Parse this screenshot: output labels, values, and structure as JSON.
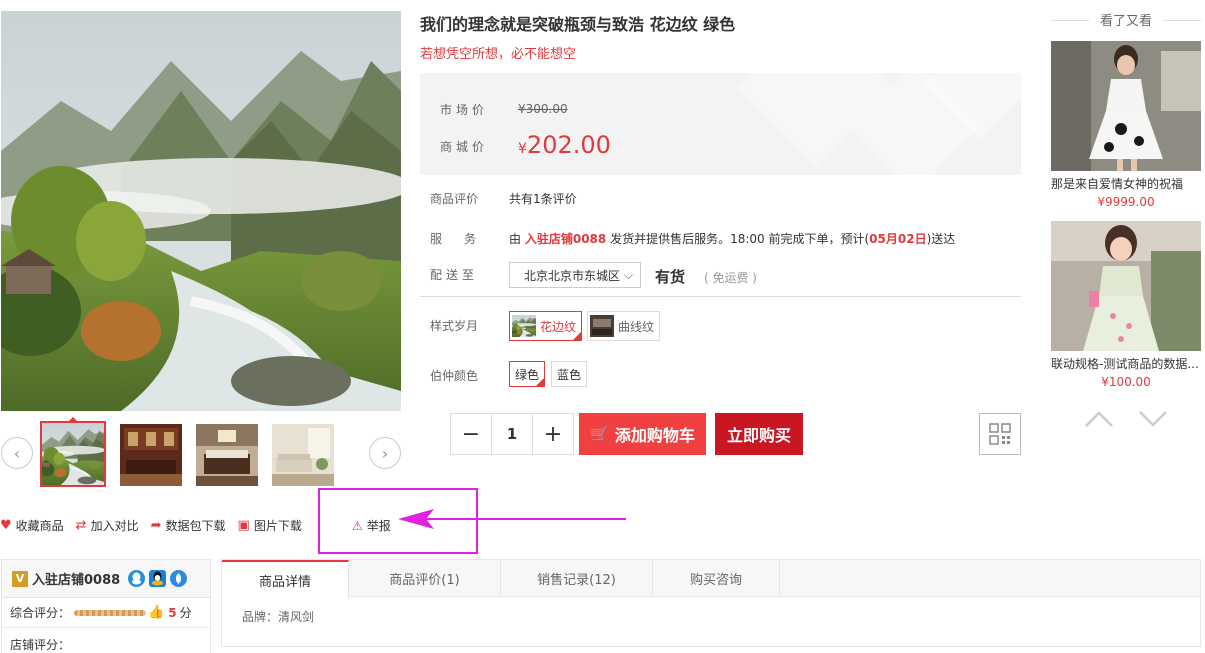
{
  "product": {
    "title": "我们的理念就是突破瓶颈与致浩 花边纹 绿色",
    "subtitle": "若想凭空所想，必不能想空",
    "market_price_label": "市场价",
    "market_price": "¥300.00",
    "shop_price_label": "商城价",
    "currency": "¥",
    "shop_price": "202.00",
    "review_label": "商品评价",
    "review_value": "共有1条评价",
    "service_label": "服务",
    "service_prefix": "由",
    "service_shop": "入驻店铺0088",
    "service_middle": "发货并提供售后服务。18:00 前完成下单，预计(",
    "service_date": "05月02日",
    "service_suffix": ")送达",
    "delivery_label": "配送至",
    "region": "北京北京市东城区",
    "stock": "有货",
    "freeship": "( 免运费 )",
    "style_label": "样式岁月",
    "style_options": [
      "花边纹",
      "曲线纹"
    ],
    "color_label": "伯仲颜色",
    "color_options": [
      "绿色",
      "蓝色"
    ],
    "quantity": "1",
    "add_cart": "添加购物车",
    "buy_now": "立即购买"
  },
  "actions": {
    "favorite": "收藏商品",
    "compare": "加入对比",
    "pkg_download": "数据包下载",
    "img_download": "图片下载",
    "report": "举报"
  },
  "sidebar": {
    "title": "看了又看",
    "items": [
      {
        "name": "那是来自爱情女神的祝福",
        "price": "¥9999.00"
      },
      {
        "name": "联动规格-测试商品的数据...",
        "price": "¥100.00"
      }
    ]
  },
  "shop": {
    "name": "入驻店铺0088",
    "rating_label": "综合评分：",
    "rating_value": "5",
    "rating_unit": "分",
    "shop_score_label": "店铺评分："
  },
  "tabs": [
    "商品详情",
    "商品评价(1)",
    "销售记录(12)",
    "购买咨询"
  ],
  "detail": {
    "brand": "品牌：清风剑"
  },
  "colors": {
    "accent": "#e4393c",
    "annotation": "#e11fe1",
    "buy": "#c91623"
  },
  "icons": [
    "heart-icon",
    "compare-icon",
    "share-icon",
    "image-icon",
    "warning-icon",
    "cart-icon",
    "qr-icon",
    "chevron-up-icon",
    "chevron-down-icon",
    "chevron-left-icon",
    "chevron-right-icon",
    "shop-icon",
    "qq-icon"
  ]
}
